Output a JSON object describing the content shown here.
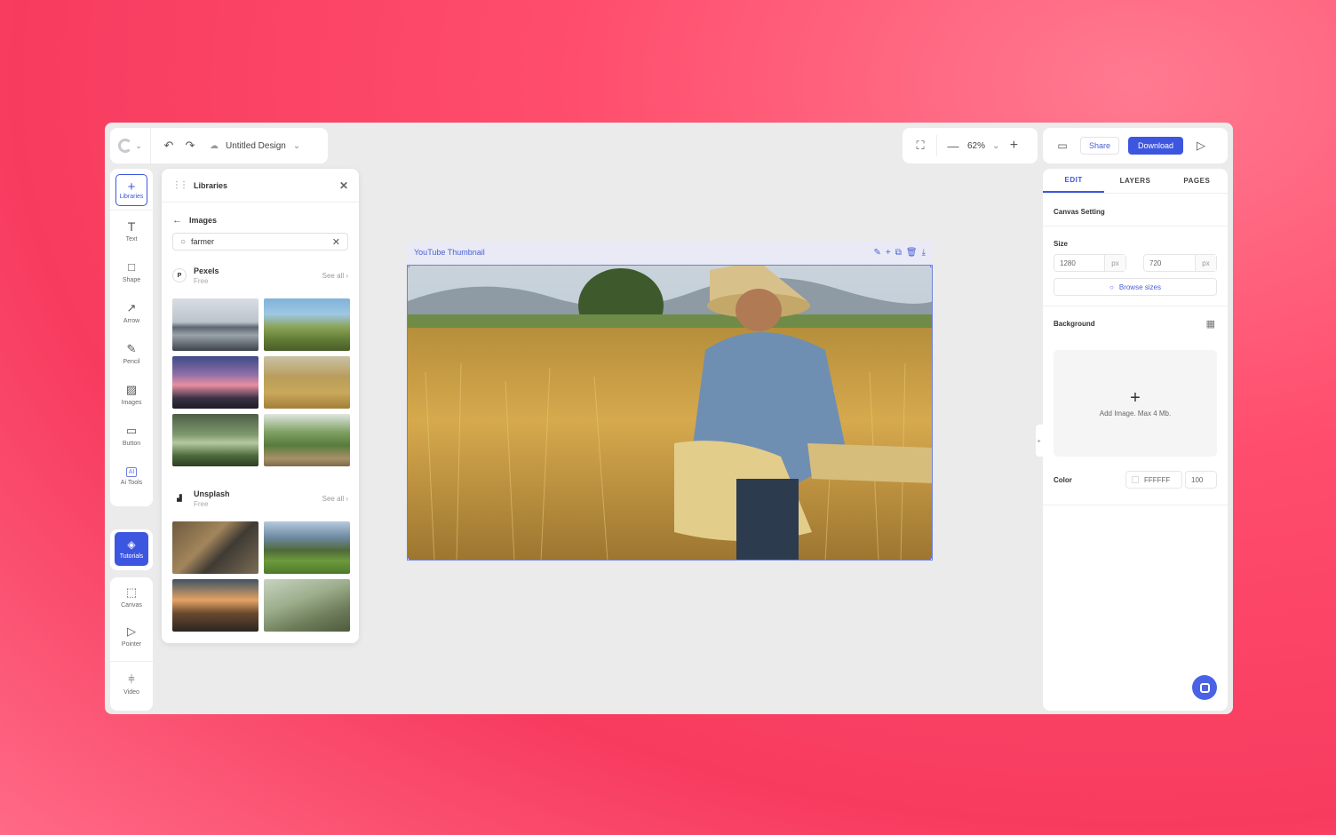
{
  "header": {
    "title": "Untitled Design",
    "zoom": "62%",
    "share_label": "Share",
    "download_label": "Download"
  },
  "toolbar": {
    "tools": [
      {
        "label": "Libraries",
        "icon": "plus-icon"
      },
      {
        "label": "Text",
        "icon": "text-icon"
      },
      {
        "label": "Shape",
        "icon": "square-icon"
      },
      {
        "label": "Arrow",
        "icon": "arrow-icon"
      },
      {
        "label": "Pencil",
        "icon": "pencil-icon"
      },
      {
        "label": "Images",
        "icon": "image-icon"
      },
      {
        "label": "Button",
        "icon": "button-icon"
      },
      {
        "label": "Ai Tools",
        "icon": "ai-icon"
      }
    ],
    "tutorials_label": "Tutorials",
    "tools2": [
      {
        "label": "Canvas",
        "icon": "canvas-icon"
      },
      {
        "label": "Pointer",
        "icon": "pointer-icon"
      },
      {
        "label": "Video",
        "icon": "video-icon"
      }
    ]
  },
  "libraries": {
    "title": "Libraries",
    "breadcrumb": "Images",
    "search_value": "farmer",
    "sources": [
      {
        "name": "Pexels",
        "sub": "Free",
        "see_all": "See all"
      },
      {
        "name": "Unsplash",
        "sub": "Free",
        "see_all": "See all"
      }
    ]
  },
  "canvas": {
    "frame_title": "YouTube Thumbnail"
  },
  "right_panel": {
    "tabs": [
      "EDIT",
      "LAYERS",
      "PAGES"
    ],
    "canvas_setting": "Canvas Setting",
    "size_label": "Size",
    "width": "1280",
    "height": "720",
    "unit": "px",
    "browse_sizes": "Browse sizes",
    "background_label": "Background",
    "add_image": "Add Image. Max 4 Mb.",
    "color_label": "Color",
    "color_value": "FFFFFF",
    "opacity": "100"
  },
  "colors": {
    "accent": "#3d56e0",
    "background": "#ff4d6d"
  }
}
